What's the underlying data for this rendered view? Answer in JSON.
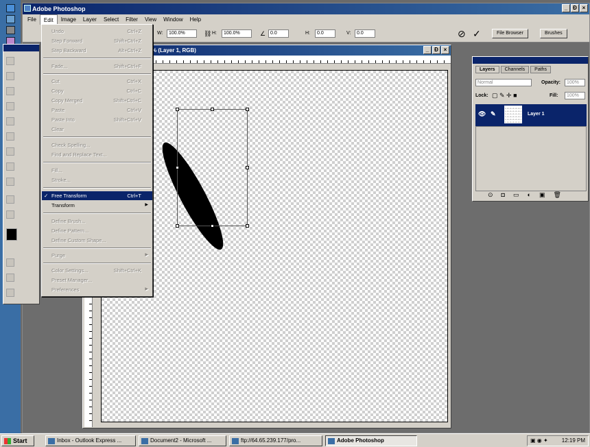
{
  "app": {
    "title": "Adobe Photoshop",
    "window_buttons": [
      "_",
      "Ɖ",
      "×"
    ]
  },
  "menubar": [
    "File",
    "Edit",
    "Image",
    "Layer",
    "Select",
    "Filter",
    "View",
    "Window",
    "Help"
  ],
  "options": {
    "w_label": "W:",
    "w_value": "100.0%",
    "h_label": "H:",
    "h_value": "100.0%",
    "angle_value": "0.0",
    "h_skew_label": "H:",
    "h_skew_value": "0.0",
    "v_skew_label": "V:",
    "v_skew_value": "0.0",
    "file_browser": "File Browser",
    "brushes": "Brushes"
  },
  "document": {
    "title": "% (Layer 1, RGB)"
  },
  "edit_menu": [
    {
      "label": "Undo",
      "shortcut": "Ctrl+Z",
      "enabled": false
    },
    {
      "label": "Step Forward",
      "shortcut": "Shift+Ctrl+Z",
      "enabled": false
    },
    {
      "label": "Step Backward",
      "shortcut": "Alt+Ctrl+Z",
      "enabled": false
    },
    {
      "label": "Fade...",
      "shortcut": "Shift+Ctrl+F",
      "enabled": false
    },
    {
      "label": "Cut",
      "shortcut": "Ctrl+X",
      "enabled": false
    },
    {
      "label": "Copy",
      "shortcut": "Ctrl+C",
      "enabled": false
    },
    {
      "label": "Copy Merged",
      "shortcut": "Shift+Ctrl+C",
      "enabled": false
    },
    {
      "label": "Paste",
      "shortcut": "Ctrl+V",
      "enabled": false
    },
    {
      "label": "Paste Into",
      "shortcut": "Shift+Ctrl+V",
      "enabled": false
    },
    {
      "label": "Clear",
      "shortcut": "",
      "enabled": false
    },
    {
      "label": "Check Spelling...",
      "shortcut": "",
      "enabled": false
    },
    {
      "label": "Find and Replace Text...",
      "shortcut": "",
      "enabled": false
    },
    {
      "label": "Fill...",
      "shortcut": "",
      "enabled": false
    },
    {
      "label": "Stroke...",
      "shortcut": "",
      "enabled": false
    },
    {
      "label": "Free Transform",
      "shortcut": "Ctrl+T",
      "enabled": true,
      "selected": true,
      "checked": true
    },
    {
      "label": "Transform",
      "shortcut": "",
      "enabled": true,
      "submenu": true
    },
    {
      "label": "Define Brush...",
      "shortcut": "",
      "enabled": false
    },
    {
      "label": "Define Pattern...",
      "shortcut": "",
      "enabled": false
    },
    {
      "label": "Define Custom Shape...",
      "shortcut": "",
      "enabled": false
    },
    {
      "label": "Purge",
      "shortcut": "",
      "enabled": false,
      "submenu": true
    },
    {
      "label": "Color Settings...",
      "shortcut": "Shift+Ctrl+K",
      "enabled": false
    },
    {
      "label": "Preset Manager...",
      "shortcut": "",
      "enabled": false
    },
    {
      "label": "Preferences",
      "shortcut": "",
      "enabled": false,
      "submenu": true
    }
  ],
  "layers": {
    "tabs": [
      "Layers",
      "Channels",
      "Paths"
    ],
    "blend_mode": "Normal",
    "opacity_label": "Opacity:",
    "opacity_value": "100%",
    "lock_label": "Lock:",
    "fill_label": "Fill:",
    "fill_value": "100%",
    "layer_name": "Layer 1"
  },
  "taskbar": {
    "start": "Start",
    "tasks": [
      "Inbox - Outlook Express ...",
      "Document2 - Microsoft ...",
      "ftp://64.65.239.177/pro...",
      "Adobe Photoshop"
    ],
    "clock": "12:19 PM"
  }
}
